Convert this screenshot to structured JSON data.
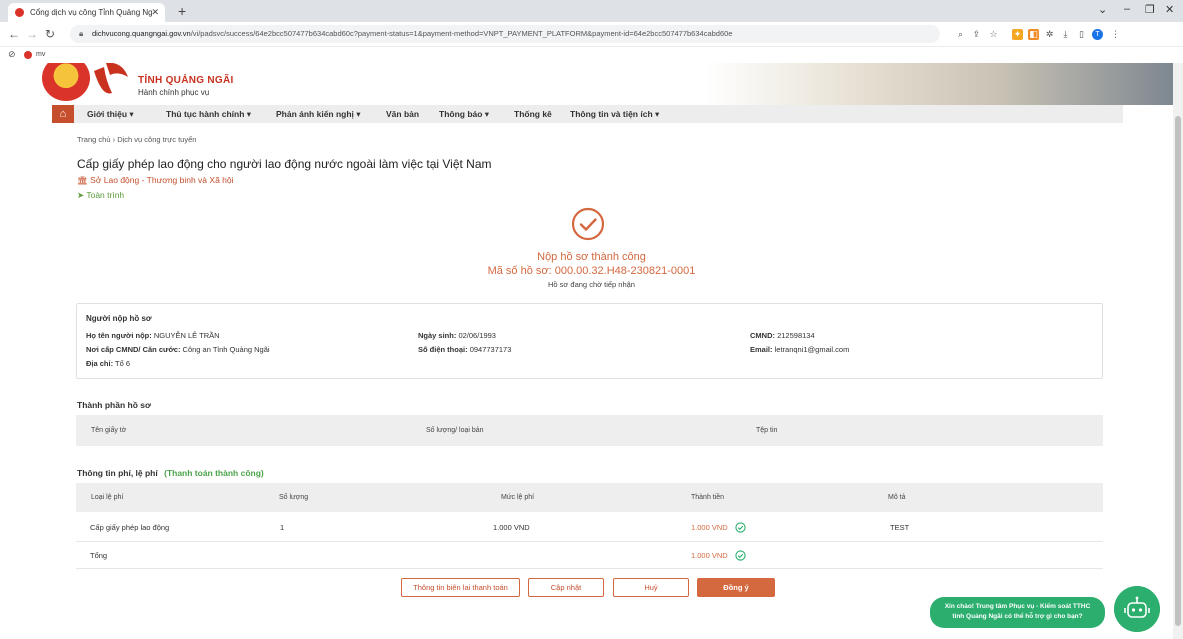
{
  "browser": {
    "tab_title": "Cổng dịch vụ công Tỉnh Quảng Ng",
    "url_host": "dichvucong.quangngai.gov.vn",
    "url_path": "/vi/padsvc/success/64e2bcc507477b634cabd60c?payment-status=1&payment-method=VNPT_PAYMENT_PLATFORM&payment-id=64e2bcc507477b634cabd60e",
    "bookmark": "mv",
    "profile_initial": "T"
  },
  "header": {
    "site_title": "TỈNH QUẢNG NGÃI",
    "site_subtitle": "Hành chính phục vụ"
  },
  "nav": {
    "items": [
      "Giới thiệu",
      "Thủ tục hành chính",
      "Phản ánh kiến nghị",
      "Văn bản",
      "Thông báo",
      "Thống kê",
      "Thông tin và tiện ích"
    ]
  },
  "breadcrumb": {
    "home": "Trang chủ",
    "current": "Dịch vụ công trực tuyến"
  },
  "procedure": {
    "title": "Cấp giấy phép lao động cho người lao động nước ngoài làm việc tại Việt Nam",
    "agency": "Sở Lao động - Thương binh và Xã hội",
    "process": "Toàn trình"
  },
  "success": {
    "title": "Nộp hồ sơ thành công",
    "code": "Mã số hồ sơ: 000.00.32.H48-230821-0001",
    "status": "Hồ sơ đang chờ tiếp nhận"
  },
  "applicant": {
    "heading": "Người nộp hồ sơ",
    "name_label": "Họ tên người nộp:",
    "name": "NGUYỄN LÊ TRẦN",
    "dob_label": "Ngày sinh:",
    "dob": "02/06/1993",
    "id_label": "CMND:",
    "id": "212598134",
    "issuer_label": "Nơi cấp CMND/ Căn cước:",
    "issuer": "Công an Tỉnh Quảng Ngãi",
    "phone_label": "Số điện thoại:",
    "phone": "0947737173",
    "email_label": "Email:",
    "email": "letranqni1@gmail.com",
    "address_label": "Địa chỉ:",
    "address": "Tổ 6"
  },
  "components": {
    "heading": "Thành phần hồ sơ",
    "columns": [
      "Tên giấy tờ",
      "Số lượng/ loại bản",
      "Tệp tin"
    ]
  },
  "fees": {
    "heading": "Thông tin phí, lệ phí",
    "status": "(Thanh toán thành công)",
    "columns": [
      "Loại lệ phí",
      "Số lượng",
      "Mức lệ phí",
      "Thành tiền",
      "Mô tả"
    ],
    "row": {
      "type": "Cấp giấy phép lao động",
      "qty": "1",
      "rate": "1.000 VND",
      "amount": "1.000 VND",
      "desc": "TEST"
    },
    "total_label": "Tổng",
    "total": "1.000 VND"
  },
  "actions": {
    "receipt": "Thông tin biên lai thanh toán",
    "update": "Cập nhật",
    "cancel": "Huỷ",
    "confirm": "Đồng ý"
  },
  "chat": {
    "line1": "Xin chào! Trung tâm Phục vụ - Kiểm soát TTHC",
    "line2": "tỉnh Quảng Ngãi có thể hỗ trợ gì cho bạn?"
  },
  "colors": {
    "accent": "#d4683f",
    "success_green": "#2bae6e",
    "nav_home": "#c54f2c"
  }
}
